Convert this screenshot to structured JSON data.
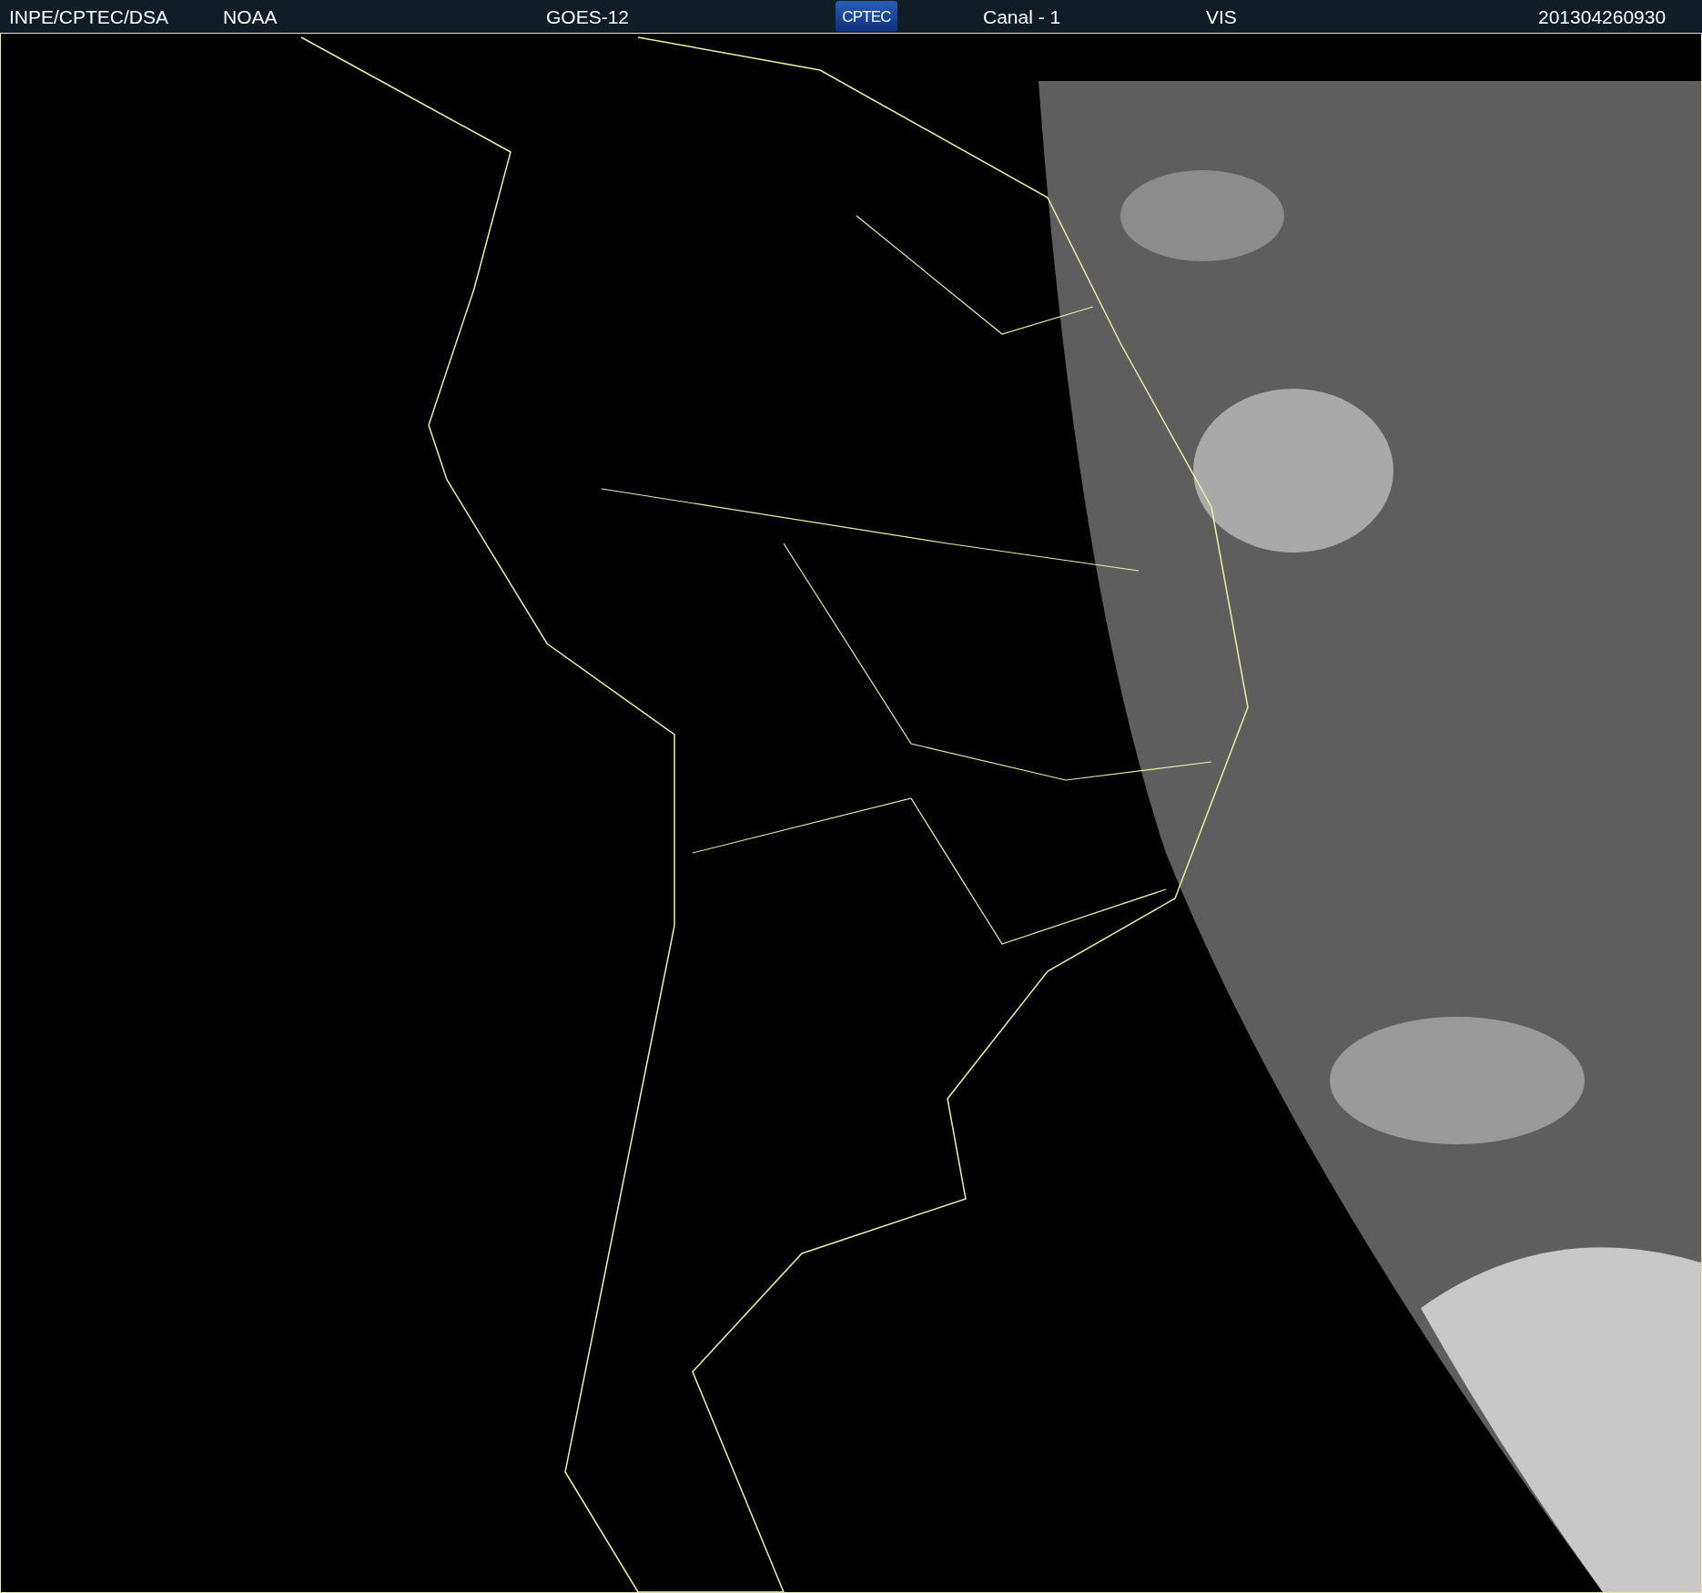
{
  "header": {
    "source": "INPE/CPTEC/DSA",
    "agency": "NOAA",
    "satellite": "GOES-12",
    "logo": "CPTEC",
    "channel": "Canal - 1",
    "band": "VIS",
    "timestamp": "201304260930"
  }
}
